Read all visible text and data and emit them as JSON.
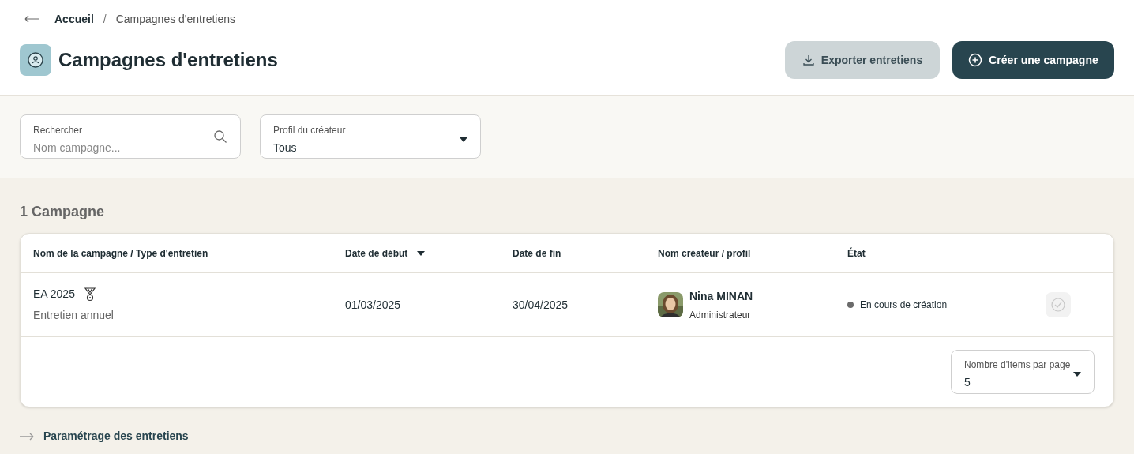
{
  "breadcrumb": {
    "items": [
      "Accueil",
      "Campagnes d'entretiens"
    ],
    "separator": "/"
  },
  "title": "Campagnes d'entretiens",
  "actions": [
    {
      "kind": "export",
      "label": "Exporter entretiens"
    },
    {
      "kind": "create",
      "label": "Créer une campagne"
    }
  ],
  "filters": {
    "search": {
      "label": "Rechercher",
      "placeholder": "Nom campagne..."
    },
    "creator_profile": {
      "label": "Profil du créateur",
      "value": "Tous"
    }
  },
  "count": "1 Campagne",
  "table": {
    "columns": [
      {
        "label": "Nom de la campagne / Type d'entretien",
        "sorted": false
      },
      {
        "label": "Date de début",
        "sorted": true
      },
      {
        "label": "Date de fin",
        "sorted": false
      },
      {
        "label": "Nom créateur / profil",
        "sorted": false
      },
      {
        "label": "État",
        "sorted": false
      }
    ],
    "rows": [
      {
        "name": "EA 2025",
        "type": "Entretien annuel",
        "start": "01/03/2025",
        "end": "30/04/2025",
        "creator": "Nina MINAN",
        "profile": "Administrateur",
        "status": "En cours de création",
        "color": "#6b6b6b",
        "action_disabled": true
      }
    ]
  },
  "pagination": {
    "label": "Nombre d'items par page",
    "value": "5"
  },
  "footer_link": "Paramétrage des entretiens"
}
